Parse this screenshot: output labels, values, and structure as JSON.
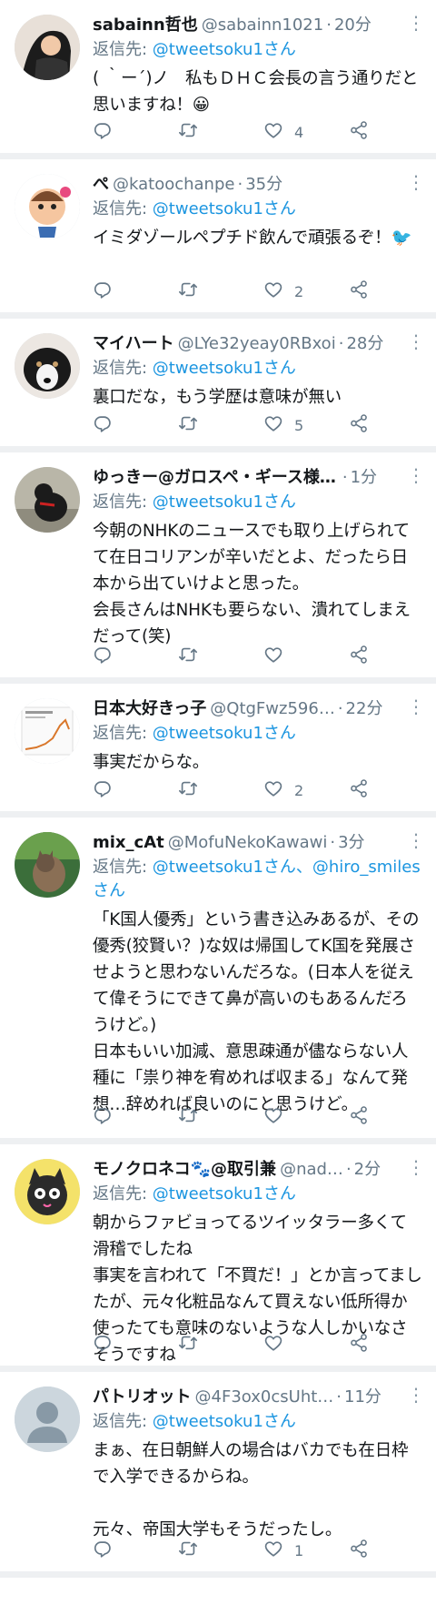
{
  "colors": {
    "link": "#1b95e0",
    "secondary": "#657786",
    "divider": "#eef0f2"
  },
  "icons": {
    "reply": "reply-icon",
    "retweet": "retweet-icon",
    "like": "heart-icon",
    "share": "share-icon",
    "more": "chevron-down-icon"
  },
  "tweets": [
    {
      "name": "sabainn哲也",
      "handle": "@sabainn1021",
      "sep": "·",
      "time": "20分",
      "reply_label": "返信先: ",
      "reply_to": "@tweetsoku1さん",
      "text": "( ｀ー´)ノ　私もＤＨＣ会長の言う通りだと思いますね！😀",
      "replies": "",
      "retweets": "",
      "likes": "4"
    },
    {
      "name": "ぺ",
      "handle": "@katoochanpe",
      "sep": "·",
      "time": "35分",
      "reply_label": "返信先: ",
      "reply_to": "@tweetsoku1さん",
      "text": "イミダゾールペプチド飲んで頑張るぞ！🐦",
      "replies": "",
      "retweets": "",
      "likes": "2"
    },
    {
      "name": "マイハート",
      "handle": "@LYe32yeay0RBxoi",
      "sep": "·",
      "time": "28分",
      "reply_label": "返信先: ",
      "reply_to": "@tweetsoku1さん",
      "text": "裏口だな，もう学歴は意味が無い",
      "replies": "",
      "retweets": "",
      "likes": "5"
    },
    {
      "name": "ゆっきー@ガロスペ・ギース様…",
      "handle": "",
      "sep": "·",
      "time": "1分",
      "reply_label": "返信先: ",
      "reply_to": "@tweetsoku1さん",
      "text": "今朝のNHKのニュースでも取り上げられてて在日コリアンが辛いだとよ、だったら日本から出ていけよと思った。\n会長さんはNHKも要らない、潰れてしまえだって(笑)",
      "replies": "",
      "retweets": "",
      "likes": ""
    },
    {
      "name": "日本大好きっ子",
      "handle": "@QtgFwz596…",
      "sep": "·",
      "time": "22分",
      "reply_label": "返信先: ",
      "reply_to": "@tweetsoku1さん",
      "text": "事実だからな。",
      "replies": "",
      "retweets": "",
      "likes": "2"
    },
    {
      "name": "mix_cAt",
      "handle": "@MofuNekoKawawi",
      "sep": "·",
      "time": "3分",
      "reply_label": "返信先: ",
      "reply_to": "@tweetsoku1さん、@hiro_smilesさん",
      "text": "「K国人優秀」という書き込みあるが、その優秀(狡賢い？)な奴は帰国してK国を発展させようと思わないんだろな。(日本人を従えて偉そうにできて鼻が高いのもあるんだろうけど。)\n日本もいい加減、意思疎通が儘ならない人種に「祟り神を宥めれば収まる」なんて発想…辞めれば良いのにと思うけど。",
      "replies": "",
      "retweets": "",
      "likes": ""
    },
    {
      "name": "モノクロネコ🐾@取引兼",
      "handle": "@nad…",
      "sep": "·",
      "time": "2分",
      "reply_label": "返信先: ",
      "reply_to": "@tweetsoku1さん",
      "text": "朝からファビョってるツイッタラー多くて滑稽でしたね\n事実を言われて「不買だ！」とか言ってましたが、元々化粧品なんて買えない低所得か使ったても意味のないような人しかいなさそうですね",
      "replies": "",
      "retweets": "",
      "likes": ""
    },
    {
      "name": "パトリオット",
      "handle": "@4F3ox0csUht…",
      "sep": "·",
      "time": "11分",
      "reply_label": "返信先: ",
      "reply_to": "@tweetsoku1さん",
      "text": "まぁ、在日朝鮮人の場合はバカでも在日枠で入学できるからね。\n\n元々、帝国大学もそうだったし。",
      "replies": "",
      "retweets": "",
      "likes": "1"
    }
  ]
}
